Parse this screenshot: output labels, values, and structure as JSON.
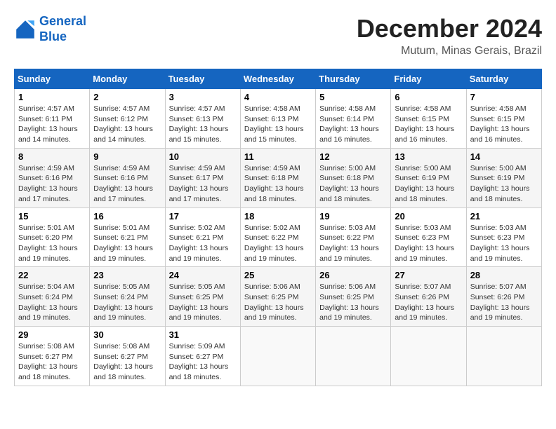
{
  "header": {
    "logo_line1": "General",
    "logo_line2": "Blue",
    "month_title": "December 2024",
    "location": "Mutum, Minas Gerais, Brazil"
  },
  "weekdays": [
    "Sunday",
    "Monday",
    "Tuesday",
    "Wednesday",
    "Thursday",
    "Friday",
    "Saturday"
  ],
  "weeks": [
    [
      {
        "day": "1",
        "info": "Sunrise: 4:57 AM\nSunset: 6:11 PM\nDaylight: 13 hours\nand 14 minutes."
      },
      {
        "day": "2",
        "info": "Sunrise: 4:57 AM\nSunset: 6:12 PM\nDaylight: 13 hours\nand 14 minutes."
      },
      {
        "day": "3",
        "info": "Sunrise: 4:57 AM\nSunset: 6:13 PM\nDaylight: 13 hours\nand 15 minutes."
      },
      {
        "day": "4",
        "info": "Sunrise: 4:58 AM\nSunset: 6:13 PM\nDaylight: 13 hours\nand 15 minutes."
      },
      {
        "day": "5",
        "info": "Sunrise: 4:58 AM\nSunset: 6:14 PM\nDaylight: 13 hours\nand 16 minutes."
      },
      {
        "day": "6",
        "info": "Sunrise: 4:58 AM\nSunset: 6:15 PM\nDaylight: 13 hours\nand 16 minutes."
      },
      {
        "day": "7",
        "info": "Sunrise: 4:58 AM\nSunset: 6:15 PM\nDaylight: 13 hours\nand 16 minutes."
      }
    ],
    [
      {
        "day": "8",
        "info": "Sunrise: 4:59 AM\nSunset: 6:16 PM\nDaylight: 13 hours\nand 17 minutes."
      },
      {
        "day": "9",
        "info": "Sunrise: 4:59 AM\nSunset: 6:16 PM\nDaylight: 13 hours\nand 17 minutes."
      },
      {
        "day": "10",
        "info": "Sunrise: 4:59 AM\nSunset: 6:17 PM\nDaylight: 13 hours\nand 17 minutes."
      },
      {
        "day": "11",
        "info": "Sunrise: 4:59 AM\nSunset: 6:18 PM\nDaylight: 13 hours\nand 18 minutes."
      },
      {
        "day": "12",
        "info": "Sunrise: 5:00 AM\nSunset: 6:18 PM\nDaylight: 13 hours\nand 18 minutes."
      },
      {
        "day": "13",
        "info": "Sunrise: 5:00 AM\nSunset: 6:19 PM\nDaylight: 13 hours\nand 18 minutes."
      },
      {
        "day": "14",
        "info": "Sunrise: 5:00 AM\nSunset: 6:19 PM\nDaylight: 13 hours\nand 18 minutes."
      }
    ],
    [
      {
        "day": "15",
        "info": "Sunrise: 5:01 AM\nSunset: 6:20 PM\nDaylight: 13 hours\nand 19 minutes."
      },
      {
        "day": "16",
        "info": "Sunrise: 5:01 AM\nSunset: 6:21 PM\nDaylight: 13 hours\nand 19 minutes."
      },
      {
        "day": "17",
        "info": "Sunrise: 5:02 AM\nSunset: 6:21 PM\nDaylight: 13 hours\nand 19 minutes."
      },
      {
        "day": "18",
        "info": "Sunrise: 5:02 AM\nSunset: 6:22 PM\nDaylight: 13 hours\nand 19 minutes."
      },
      {
        "day": "19",
        "info": "Sunrise: 5:03 AM\nSunset: 6:22 PM\nDaylight: 13 hours\nand 19 minutes."
      },
      {
        "day": "20",
        "info": "Sunrise: 5:03 AM\nSunset: 6:23 PM\nDaylight: 13 hours\nand 19 minutes."
      },
      {
        "day": "21",
        "info": "Sunrise: 5:03 AM\nSunset: 6:23 PM\nDaylight: 13 hours\nand 19 minutes."
      }
    ],
    [
      {
        "day": "22",
        "info": "Sunrise: 5:04 AM\nSunset: 6:24 PM\nDaylight: 13 hours\nand 19 minutes."
      },
      {
        "day": "23",
        "info": "Sunrise: 5:05 AM\nSunset: 6:24 PM\nDaylight: 13 hours\nand 19 minutes."
      },
      {
        "day": "24",
        "info": "Sunrise: 5:05 AM\nSunset: 6:25 PM\nDaylight: 13 hours\nand 19 minutes."
      },
      {
        "day": "25",
        "info": "Sunrise: 5:06 AM\nSunset: 6:25 PM\nDaylight: 13 hours\nand 19 minutes."
      },
      {
        "day": "26",
        "info": "Sunrise: 5:06 AM\nSunset: 6:25 PM\nDaylight: 13 hours\nand 19 minutes."
      },
      {
        "day": "27",
        "info": "Sunrise: 5:07 AM\nSunset: 6:26 PM\nDaylight: 13 hours\nand 19 minutes."
      },
      {
        "day": "28",
        "info": "Sunrise: 5:07 AM\nSunset: 6:26 PM\nDaylight: 13 hours\nand 19 minutes."
      }
    ],
    [
      {
        "day": "29",
        "info": "Sunrise: 5:08 AM\nSunset: 6:27 PM\nDaylight: 13 hours\nand 18 minutes."
      },
      {
        "day": "30",
        "info": "Sunrise: 5:08 AM\nSunset: 6:27 PM\nDaylight: 13 hours\nand 18 minutes."
      },
      {
        "day": "31",
        "info": "Sunrise: 5:09 AM\nSunset: 6:27 PM\nDaylight: 13 hours\nand 18 minutes."
      },
      null,
      null,
      null,
      null
    ]
  ]
}
